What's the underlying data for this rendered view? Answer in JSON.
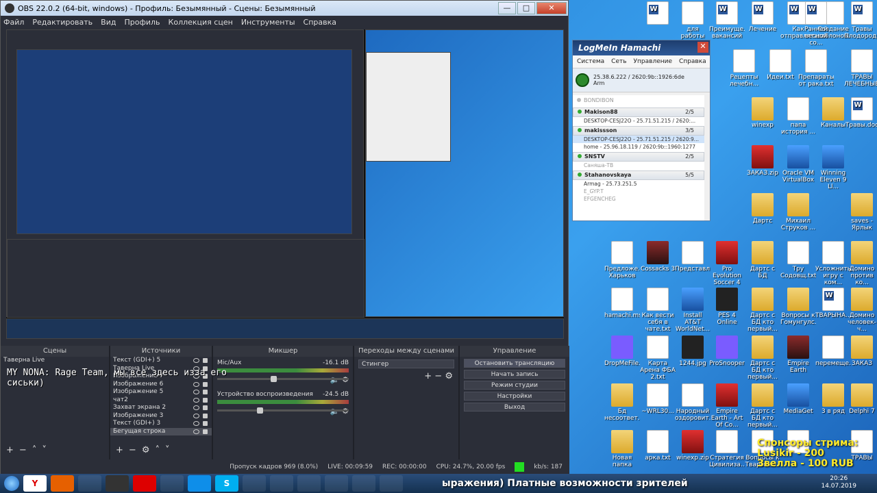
{
  "obs": {
    "title": "OBS 22.0.2 (64-bit, windows) - Профиль: Безымянный - Сцены: Безымянный",
    "menu": [
      "Файл",
      "Редактировать",
      "Вид",
      "Профиль",
      "Коллекция сцен",
      "Инструменты",
      "Справка"
    ],
    "window_buttons": {
      "minimize": "—",
      "maximize": "□",
      "close": "✕"
    },
    "docks": {
      "scenes": {
        "title": "Сцены",
        "items": [
          "Таверна Live"
        ]
      },
      "sources": {
        "title": "Источники",
        "items": [
          "Текст (GDI+) 5",
          "Таверна Live",
          "Изображение 7",
          "Изображение 6",
          "Изображение 5",
          "чат2",
          "Захват экрана 2",
          "Изображение 3",
          "Текст (GDI+) 3",
          "Бегущая строка"
        ]
      },
      "mixer": {
        "title": "Микшер",
        "tracks": [
          {
            "name": "Mic/Aux",
            "level": "-16.1 dB"
          },
          {
            "name": "Устройство воспроизведения",
            "level": "-24.5 dB"
          }
        ]
      },
      "transitions": {
        "title": "Переходы между сценами",
        "selected": "Стингер"
      },
      "controls": {
        "title": "Управление",
        "buttons": [
          "Остановить трансляцию",
          "Начать запись",
          "Режим студии",
          "Настройки",
          "Выход"
        ]
      }
    },
    "status": {
      "dropped": "Пропуск кадров 969 (8.0%)",
      "live": "LIVE: 00:09:59",
      "rec": "REC: 00:00:00",
      "cpu": "CPU: 24.7%, 20.00 fps",
      "kbps": "kb/s: 187"
    }
  },
  "overlay": {
    "chat_line": "MY NONA: Rage Team, мы все здесь изза его сиськи)",
    "sponsor": "Спонсоры стрима: Lusikir - 200 Звелла - 100 RUB",
    "ticker": "ыражения) Платные возможности зрителей"
  },
  "hamachi": {
    "title": "LogMeIn Hamachi",
    "menu": [
      "Система",
      "Сеть",
      "Управление",
      "Справка"
    ],
    "self_ip": "25.38.6.222 / 2620:9b::1926:6de",
    "self_name": "Arm",
    "networks": [
      {
        "name": "BONDIBON",
        "count": "",
        "peers": []
      },
      {
        "name": "Makison88",
        "count": "2/5",
        "peers": [
          "DESKTOP-CESJ22O - 25.71.51.215 / 2620:..."
        ]
      },
      {
        "name": "makissson",
        "count": "3/5",
        "peers": [
          "DESKTOP-CESJ22O - 25.71.51.215 / 2620:9...",
          "home - 25.96.18.119 / 2620:9b::1960:1277"
        ]
      },
      {
        "name": "SNSTV",
        "count": "2/5",
        "peers": [
          "Саняша-ТВ"
        ]
      },
      {
        "name": "Stahanovskaya",
        "count": "5/5",
        "peers": [
          "Armag - 25.73.251.5",
          "E_GYP.T",
          "EFGENCHEG"
        ]
      }
    ]
  },
  "desktop_icons": [
    {
      "label": "",
      "kind": "word"
    },
    {
      "label": "для работы",
      "kind": "doc"
    },
    {
      "label": "Преимуще... вакансий",
      "kind": "word"
    },
    {
      "label": "Лечение",
      "kind": "word"
    },
    {
      "label": "Как отправлять",
      "kind": "word"
    },
    {
      "label": "Создание шаблонов...",
      "kind": "doc"
    },
    {
      "label": "Ранней весной со...",
      "kind": "word"
    },
    {
      "label": "Травы Плодород...",
      "kind": "word"
    },
    {
      "label": "Рецепты лечебн...",
      "kind": "doc"
    },
    {
      "label": "Идеи.txt",
      "kind": "doc"
    },
    {
      "label": "Препараты от рака.txt",
      "kind": "doc"
    },
    {
      "label": "ТРАВЫ ЛЕЧЕБНЫЕ...",
      "kind": "doc"
    },
    {
      "label": "winexp",
      "kind": "folder"
    },
    {
      "label": "папа история ...",
      "kind": "doc"
    },
    {
      "label": "Каналы",
      "kind": "folder"
    },
    {
      "label": "Травы.doc",
      "kind": "word"
    },
    {
      "label": "ЗАКАЗ.zip",
      "kind": "red"
    },
    {
      "label": "Oracle VM VirtualBox",
      "kind": "blue"
    },
    {
      "label": "Winning Eleven 9 Ll...",
      "kind": "blue"
    },
    {
      "label": "Дартс",
      "kind": "folder"
    },
    {
      "label": "Михаил Струков ...",
      "kind": "folder"
    },
    {
      "label": "saves - Ярлык",
      "kind": "folder"
    },
    {
      "label": "Предложе... Харьков",
      "kind": "doc"
    },
    {
      "label": "Cossacks 3",
      "kind": "game"
    },
    {
      "label": "Представл...",
      "kind": "doc"
    },
    {
      "label": "Pro Evolution Soccer 4",
      "kind": "red"
    },
    {
      "label": "Дартс с БД",
      "kind": "folder"
    },
    {
      "label": "Тру Содовщ.txt",
      "kind": "doc"
    },
    {
      "label": "Усложнить игру с ком...",
      "kind": "doc"
    },
    {
      "label": "Домино против ко...",
      "kind": "folder"
    },
    {
      "label": "hamachi.msi",
      "kind": "doc"
    },
    {
      "label": "Как вести себя в чате.txt",
      "kind": "doc"
    },
    {
      "label": "Install AT&T WorldNet...",
      "kind": "blue"
    },
    {
      "label": "PES 4 Online",
      "kind": "dark"
    },
    {
      "label": "Дартс с БД кто первый...",
      "kind": "folder"
    },
    {
      "label": "Вопросы к Гомунгулс...",
      "kind": "folder"
    },
    {
      "label": "ТВАРЫНА...",
      "kind": "word"
    },
    {
      "label": "Домино человек-ч...",
      "kind": "folder"
    },
    {
      "label": "DropMeFile...",
      "kind": "purple"
    },
    {
      "label": "Карта Арена ФБА 2.txt",
      "kind": "doc"
    },
    {
      "label": "1244.jpg",
      "kind": "dark"
    },
    {
      "label": "ProSnooper",
      "kind": "purple"
    },
    {
      "label": "Дартс с БД кто первый...",
      "kind": "folder"
    },
    {
      "label": "Empire Earth",
      "kind": "game"
    },
    {
      "label": "перемеще...",
      "kind": "doc"
    },
    {
      "label": "ЗАКАЗ",
      "kind": "folder"
    },
    {
      "label": "Бд несоответ...",
      "kind": "folder"
    },
    {
      "label": "~WRL30...",
      "kind": "doc"
    },
    {
      "label": "Народный оздоровит...",
      "kind": "doc"
    },
    {
      "label": "Empire Earth - Art Of Co...",
      "kind": "red"
    },
    {
      "label": "Дартс с БД кто первый...",
      "kind": "folder"
    },
    {
      "label": "MediaGet",
      "kind": "blue"
    },
    {
      "label": "3 в ряд",
      "kind": "folder"
    },
    {
      "label": "Delphi 7",
      "kind": "folder"
    },
    {
      "label": "Новая папка",
      "kind": "folder"
    },
    {
      "label": "арка.txt",
      "kind": "doc"
    },
    {
      "label": "winexp.zip",
      "kind": "red"
    },
    {
      "label": "Стратегия Цивилиза...",
      "kind": "doc"
    },
    {
      "label": "Вопросы к Тварыны...",
      "kind": "doc"
    },
    {
      "label": "",
      "kind": "doc"
    },
    {
      "label": "ТРАВЫ",
      "kind": "doc"
    }
  ],
  "taskbar": {
    "time": "20:26",
    "date": "14.07.2019"
  }
}
